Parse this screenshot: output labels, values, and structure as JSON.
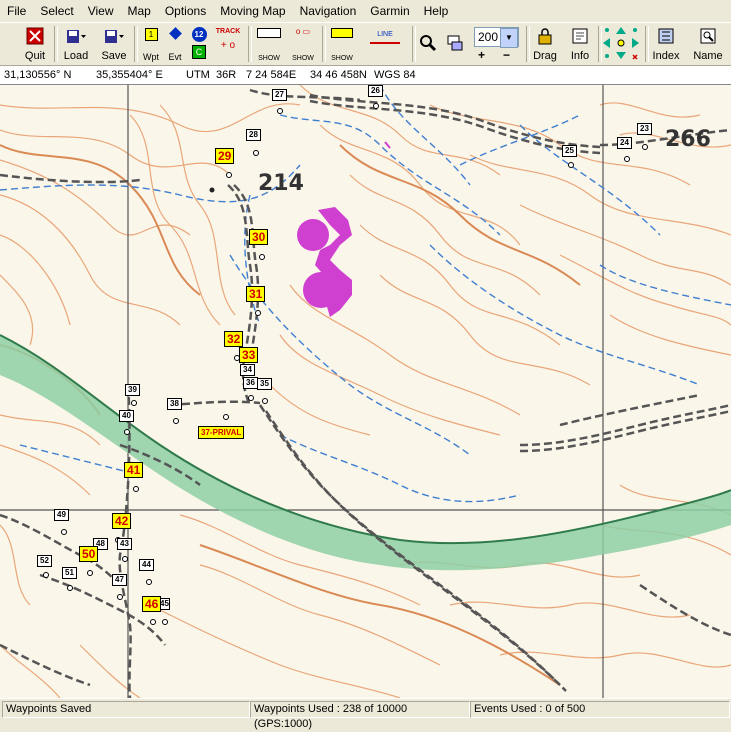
{
  "menu": [
    "File",
    "Select",
    "View",
    "Map",
    "Options",
    "Moving Map",
    "Navigation",
    "Garmin",
    "Help"
  ],
  "toolbar": {
    "quit": "Quit",
    "load": "Load",
    "save": "Save",
    "wpt": "Wpt",
    "evt": "Evt",
    "track": "TRACK",
    "show": "SHOW",
    "line": "LINE",
    "zoom_value": "200",
    "drag": "Drag",
    "info": "Info",
    "index": "Index",
    "name": "Name",
    "wpt_num": "12"
  },
  "coords": {
    "lat": "31,130556° N",
    "lon": "35,355404° E",
    "utm_label": "UTM",
    "zone": "36R",
    "easting": "7 24 584E",
    "northing": "34 46 458N",
    "datum": "WGS 84"
  },
  "map": {
    "elevation": "214",
    "elevation2": "266",
    "waypoints_small": [
      "27",
      "26",
      "28",
      "25",
      "24",
      "23",
      "34",
      "36",
      "35",
      "39",
      "40",
      "38",
      "49",
      "48",
      "43",
      "52",
      "51",
      "47",
      "44",
      "45"
    ],
    "waypoints_yellow": [
      "29",
      "30",
      "31",
      "32",
      "33",
      "41",
      "42",
      "50",
      "46"
    ],
    "label_prival": "37-PRIVAL"
  },
  "status": {
    "left": "Waypoints Saved",
    "used": "Waypoints Used : 238 of 10000  (GPS:1000)",
    "events": "Events Used : 0 of 500"
  },
  "colors": {
    "contour": "#e8a070",
    "road": "#555555",
    "stream": "#3f7fd0",
    "green_band": "#6fbf8a",
    "grid": "#444444",
    "magenta": "#d040d0"
  }
}
